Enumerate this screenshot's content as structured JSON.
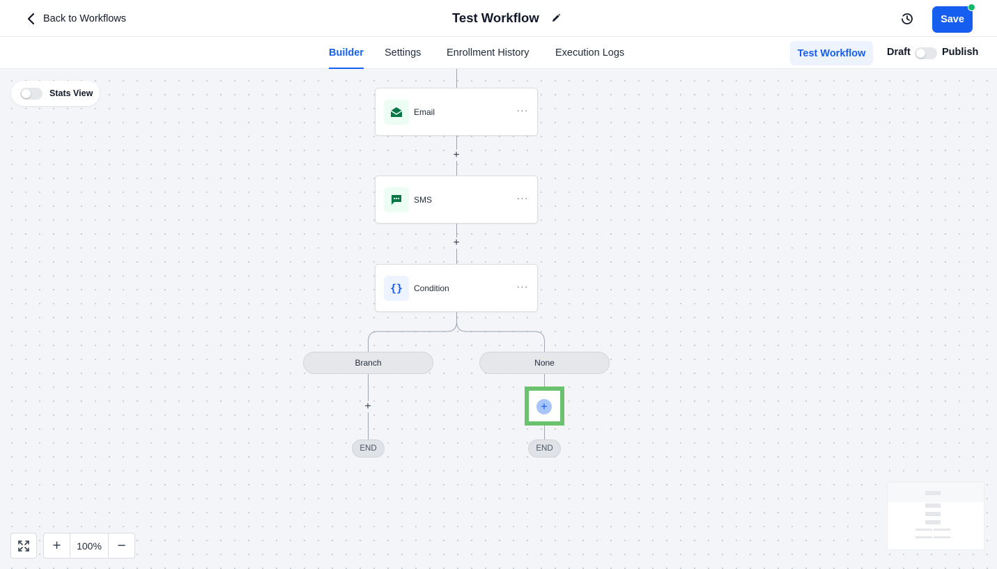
{
  "header": {
    "back_label": "Back to Workflows",
    "title": "Test Workflow",
    "save_label": "Save"
  },
  "tabs": [
    {
      "label": "Builder",
      "active": true
    },
    {
      "label": "Settings",
      "active": false
    },
    {
      "label": "Enrollment History",
      "active": false
    },
    {
      "label": "Execution Logs",
      "active": false
    }
  ],
  "toolbar": {
    "test_label": "Test Workflow",
    "draft_label": "Draft",
    "publish_label": "Publish",
    "published": false
  },
  "canvas": {
    "stats_view_label": "Stats View",
    "stats_view_on": false,
    "nodes": [
      {
        "label": "Email",
        "icon": "email-icon"
      },
      {
        "label": "SMS",
        "icon": "sms-icon"
      },
      {
        "label": "Condition",
        "icon": "condition-icon"
      }
    ],
    "condition_icon_glyph": "{}",
    "more_glyph": "···",
    "branches": [
      {
        "label": "Branch",
        "end_label": "END"
      },
      {
        "label": "None",
        "end_label": "END"
      }
    ],
    "zoom_level": "100%"
  },
  "colors": {
    "accent": "#155eef",
    "node_icon_green": "#067647",
    "highlight": "#6ac26f",
    "status_dot": "#12b76a"
  }
}
